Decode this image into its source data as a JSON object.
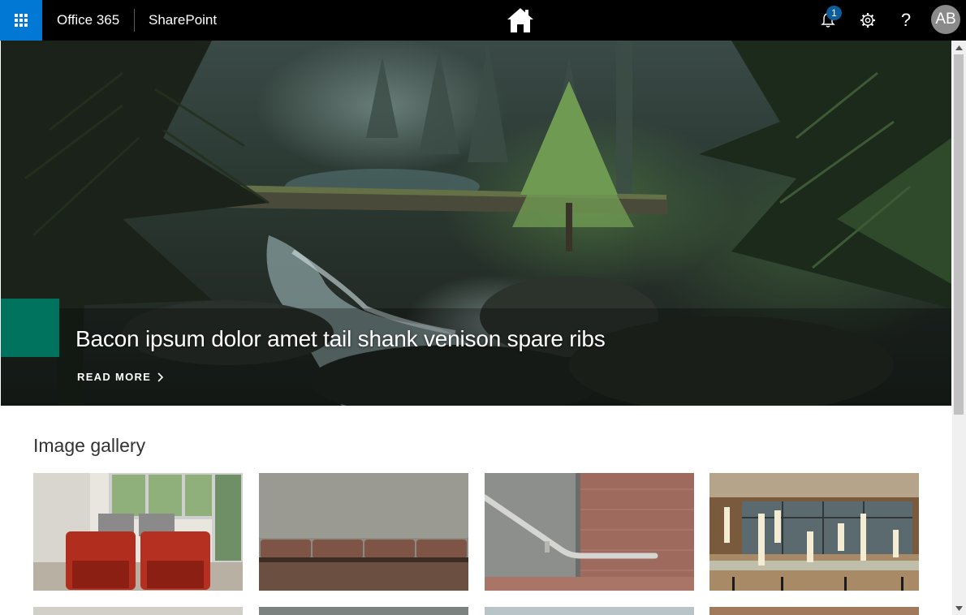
{
  "suite_bar": {
    "office_label": "Office 365",
    "app_label": "SharePoint",
    "notification_count": "1",
    "help_label": "?",
    "avatar_initials": "AB",
    "colors": {
      "bar": "#000000",
      "waffle": "#0078d4",
      "badge": "#0e5d99",
      "avatar": "#8a8a8a"
    }
  },
  "hero": {
    "title": "Bacon ipsum dolor amet tail shank venison spare ribs",
    "read_more": "READ MORE",
    "accent_color": "#00735e"
  },
  "gallery": {
    "title": "Image gallery",
    "images": [
      {
        "subject": "red-armchairs-lounge"
      },
      {
        "subject": "brown-bench-wall"
      },
      {
        "subject": "handrail-brick-wall"
      },
      {
        "subject": "pendant-lights-lobby"
      }
    ]
  }
}
